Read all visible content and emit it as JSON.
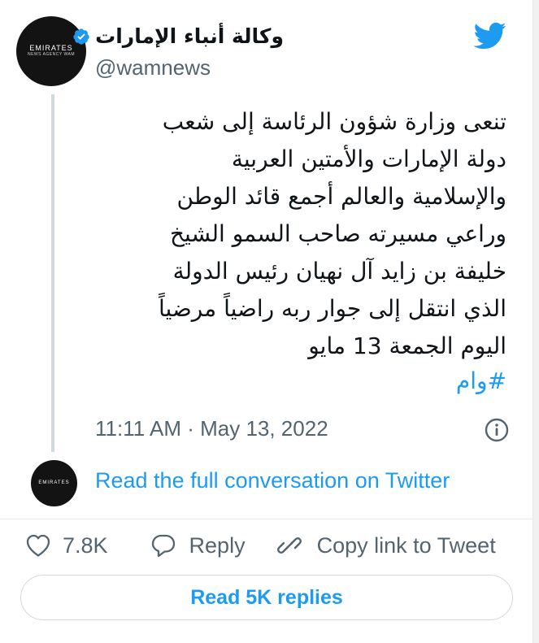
{
  "account": {
    "display_name": "وكالة أنباء الإمارات",
    "handle": "@wamnews",
    "avatar_text": "EMIRATES",
    "avatar_subtext": "NEWS AGENCY WAM"
  },
  "tweet": {
    "text": "تنعى وزارة شؤون الرئاسة إلى شعب\nدولة الإمارات والأمتين العربية\nوالإسلامية والعالم أجمع قائد الوطن\nوراعي مسيرته صاحب السمو الشيخ\nخليفة بن زايد آل نهيان رئيس الدولة\nالذي انتقل إلى جوار ربه راضياً مرضياً\nاليوم الجمعة 13 مايو",
    "hashtag": "#وام",
    "timestamp": "11:11 AM · May 13, 2022"
  },
  "conversation_link": "Read the full conversation on Twitter",
  "actions": {
    "like_count": "7.8K",
    "reply_label": "Reply",
    "copy_label": "Copy link to Tweet"
  },
  "replies_button": "Read 5K replies",
  "icons": {
    "brand": "twitter-bird-icon",
    "verified": "verified-badge-icon",
    "info": "info-icon",
    "like": "heart-icon",
    "reply": "speech-bubble-icon",
    "copy": "link-icon"
  },
  "colors": {
    "accent": "#1d9bf0",
    "text": "#0f1419",
    "secondary": "#536471",
    "avatar_bg": "#131313"
  }
}
